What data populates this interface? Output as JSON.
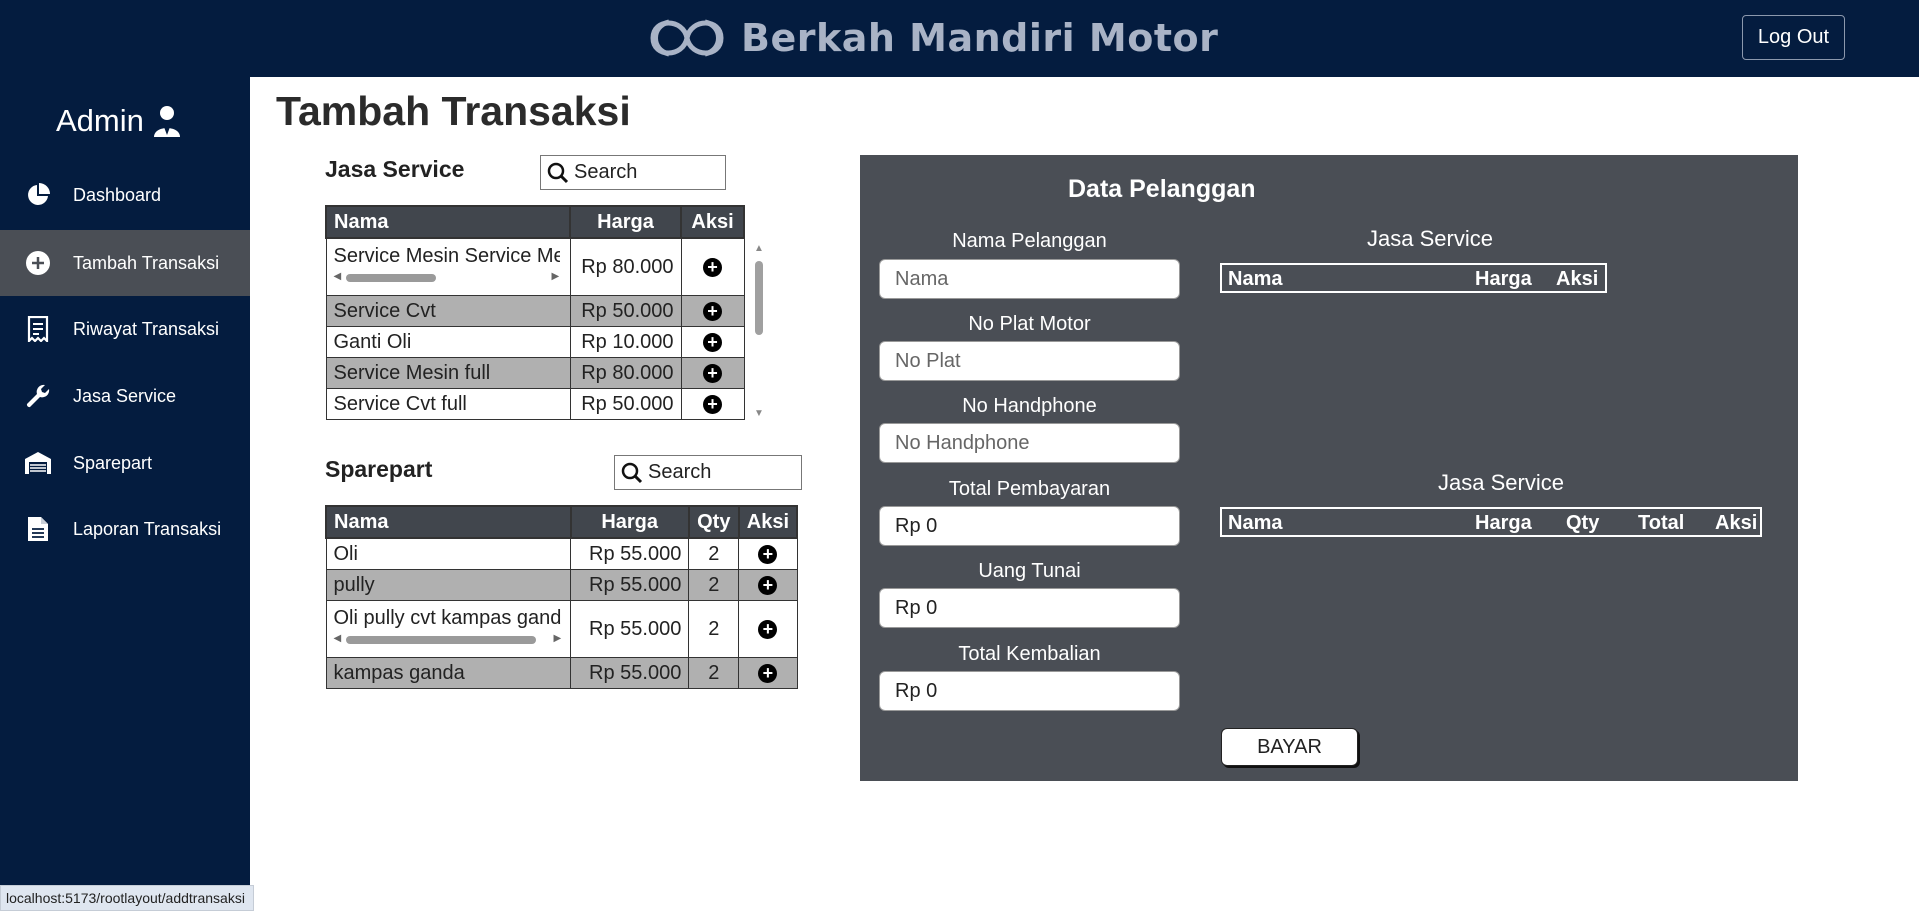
{
  "header": {
    "brand": "Berkah Mandiri Motor",
    "logout_label": "Log Out"
  },
  "sidebar": {
    "admin_label": "Admin",
    "items": [
      {
        "label": "Dashboard",
        "icon": "pie-chart-icon",
        "active": false
      },
      {
        "label": "Tambah Transaksi",
        "icon": "plus-circle-icon",
        "active": true
      },
      {
        "label": "Riwayat Transaksi",
        "icon": "receipt-icon",
        "active": false
      },
      {
        "label": "Jasa Service",
        "icon": "wrench-icon",
        "active": false
      },
      {
        "label": "Sparepart",
        "icon": "warehouse-icon",
        "active": false
      },
      {
        "label": "Laporan Transaksi",
        "icon": "document-icon",
        "active": false
      }
    ]
  },
  "page": {
    "title": "Tambah Transaksi"
  },
  "jasa_service": {
    "title": "Jasa Service",
    "search_placeholder": "Search",
    "columns": [
      "Nama",
      "Harga",
      "Aksi"
    ],
    "rows": [
      {
        "nama": "Service Mesin Service Mes",
        "harga": "Rp 80.000"
      },
      {
        "nama": "Service Cvt",
        "harga": "Rp 50.000"
      },
      {
        "nama": "Ganti Oli",
        "harga": "Rp 10.000"
      },
      {
        "nama": "Service Mesin full",
        "harga": "Rp 80.000"
      },
      {
        "nama": "Service Cvt full",
        "harga": "Rp 50.000"
      }
    ]
  },
  "sparepart": {
    "title": "Sparepart",
    "search_placeholder": "Search",
    "columns": [
      "Nama",
      "Harga",
      "Qty",
      "Aksi"
    ],
    "rows": [
      {
        "nama": "Oli",
        "harga": "Rp 55.000",
        "qty": "2"
      },
      {
        "nama": "pully",
        "harga": "Rp 55.000",
        "qty": "2"
      },
      {
        "nama": "Oli pully cvt kampas ganda",
        "harga": "Rp 55.000",
        "qty": "2"
      },
      {
        "nama": "kampas ganda",
        "harga": "Rp 55.000",
        "qty": "2"
      }
    ]
  },
  "pelanggan": {
    "title": "Data Pelanggan",
    "fields": [
      {
        "label": "Nama Pelanggan",
        "placeholder": "Nama",
        "value": ""
      },
      {
        "label": "No Plat Motor",
        "placeholder": "No Plat",
        "value": ""
      },
      {
        "label": "No Handphone",
        "placeholder": "No Handphone",
        "value": ""
      },
      {
        "label": "Total Pembayaran",
        "placeholder": "",
        "value": "Rp 0"
      },
      {
        "label": "Uang Tunai",
        "placeholder": "",
        "value": "Rp 0"
      },
      {
        "label": "Total Kembalian",
        "placeholder": "",
        "value": "Rp 0"
      }
    ],
    "selected_service": {
      "title": "Jasa Service",
      "columns": [
        "Nama",
        "Harga",
        "Aksi"
      ]
    },
    "selected_sparepart": {
      "title": "Jasa Service",
      "columns": [
        "Nama",
        "Harga",
        "Qty",
        "Total",
        "Aksi"
      ]
    },
    "pay_label": "BAYAR"
  },
  "status_bar": {
    "url": "localhost:5173/rootlayout/addtransaksi"
  },
  "colors": {
    "navy": "#041c3f",
    "panel": "#4a4e55",
    "active_nav": "#4a4e55",
    "row_alt": "#b0b0b0"
  }
}
